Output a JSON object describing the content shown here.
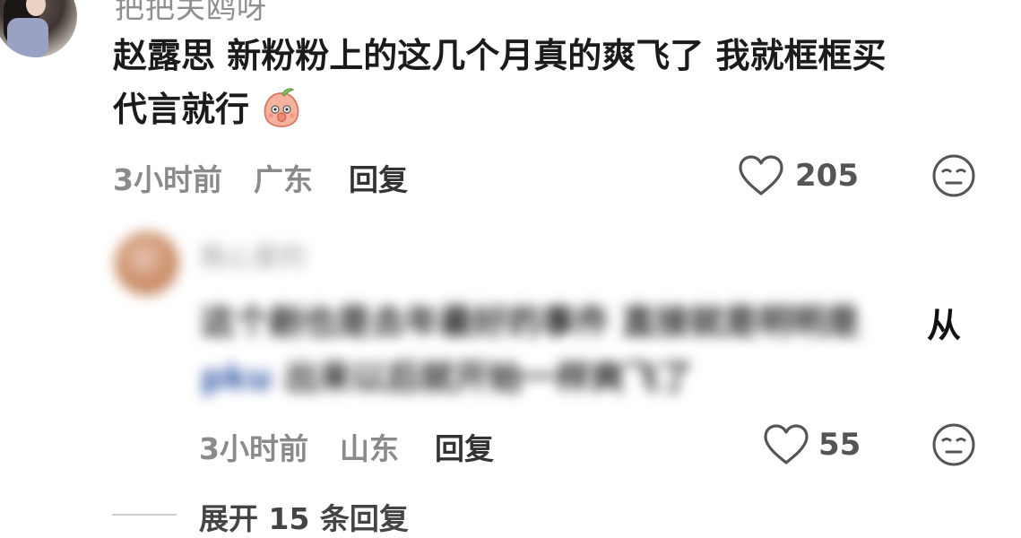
{
  "top_comment": {
    "username": "把把关鸥呀",
    "text_line1": "赵露思 新粉粉上的这几个月真的爽飞了 我就框框买",
    "text_line2": "代言就行",
    "emoji": "peach-shy-emoji",
    "time": "3小时前",
    "location": "广东",
    "reply_label": "回复",
    "like_count": "205"
  },
  "reply_comment": {
    "username": "我心爱的",
    "text_line1": "这个剧也是去年最好的事件 直接就是明明是",
    "text_line1_end": "从",
    "mention": "pku",
    "text_line2": "出来以后就开始一样爽飞了",
    "time": "3小时前",
    "location": "山东",
    "reply_label": "回复",
    "like_count": "55"
  },
  "expand_label": "展开 15 条回复",
  "colors": {
    "text_primary": "#1b1b1b",
    "text_meta": "#8a8a8a",
    "mention_blue": "#3b5ea8",
    "icon_gray": "#555555"
  }
}
